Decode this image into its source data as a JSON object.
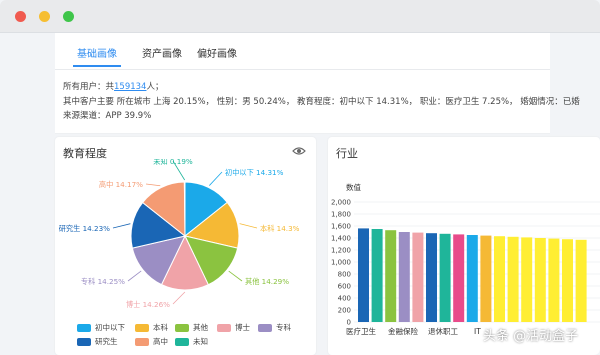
{
  "tabs": [
    {
      "label": "基础画像"
    },
    {
      "label": "资产画像"
    },
    {
      "label": "偏好画像"
    }
  ],
  "info": {
    "line1_prefix": "所有用户：共",
    "line1_count": "159134",
    "line1_suffix": "人；",
    "line2": "其中客户主要 所在城市 上海 20.15%， 性别：男 50.24%， 教育程度：初中以下 14.31%， 职业：医疗卫生 7.25%， 婚姻情况：已婚",
    "line3": "来源渠道：APP 39.9%"
  },
  "education": {
    "title": "教育程度",
    "colors": {
      "初中以下": "#1ba9e9",
      "本科": "#f5b935",
      "其他": "#8bc340",
      "博士": "#f0a3a8",
      "专科": "#9b8ec4",
      "研究生": "#1a66b5",
      "高中": "#f49b73",
      "未知": "#1fb59a"
    },
    "legend": [
      "初中以下",
      "本科",
      "其他",
      "博士",
      "专科",
      "研究生",
      "高中",
      "未知"
    ]
  },
  "chart_data": [
    {
      "type": "pie",
      "title": "教育程度",
      "labels": [
        "初中以下",
        "本科",
        "其他",
        "博士",
        "专科",
        "研究生",
        "高中",
        "未知"
      ],
      "values": [
        14.31,
        14.3,
        14.29,
        14.26,
        14.25,
        14.23,
        14.17,
        0.19
      ],
      "label_texts": [
        "初中以下 14.31%",
        "本科 14.3%",
        "其他 14.29%",
        "博士 14.26%",
        "专科 14.25%",
        "研究生 14.23%",
        "高中 14.17%",
        "未知 0.19%"
      ],
      "legend": "bottom"
    },
    {
      "type": "bar",
      "title": "行业",
      "ylabel": "数值",
      "ylim": [
        0,
        2000
      ],
      "yticks": [
        "2,000",
        "1,800",
        "1,600",
        "1,400",
        "1,200",
        "1,000",
        "800",
        "600",
        "400",
        "200",
        "0"
      ],
      "categories_visible": [
        "医疗卫生",
        "金融保险",
        "退休职工",
        "IT"
      ],
      "values": [
        1560,
        1550,
        1530,
        1500,
        1490,
        1480,
        1470,
        1460,
        1450,
        1440,
        1430,
        1420,
        1410,
        1400,
        1390,
        1380,
        1370
      ],
      "colors": [
        "#1a66b5",
        "#1fb59a",
        "#8bc340",
        "#9b8ec4",
        "#f0a3a8",
        "#1a66b5",
        "#1fb59a",
        "#e84b8a",
        "#1ba9e9",
        "#f5b935",
        "#ffee33",
        "#ffee33",
        "#ffee33",
        "#ffee33",
        "#ffee33",
        "#ffee33",
        "#ffee33"
      ]
    }
  ],
  "industry": {
    "title": "行业",
    "ylabel": "数值"
  },
  "watermark": "头条 @活动盒子"
}
